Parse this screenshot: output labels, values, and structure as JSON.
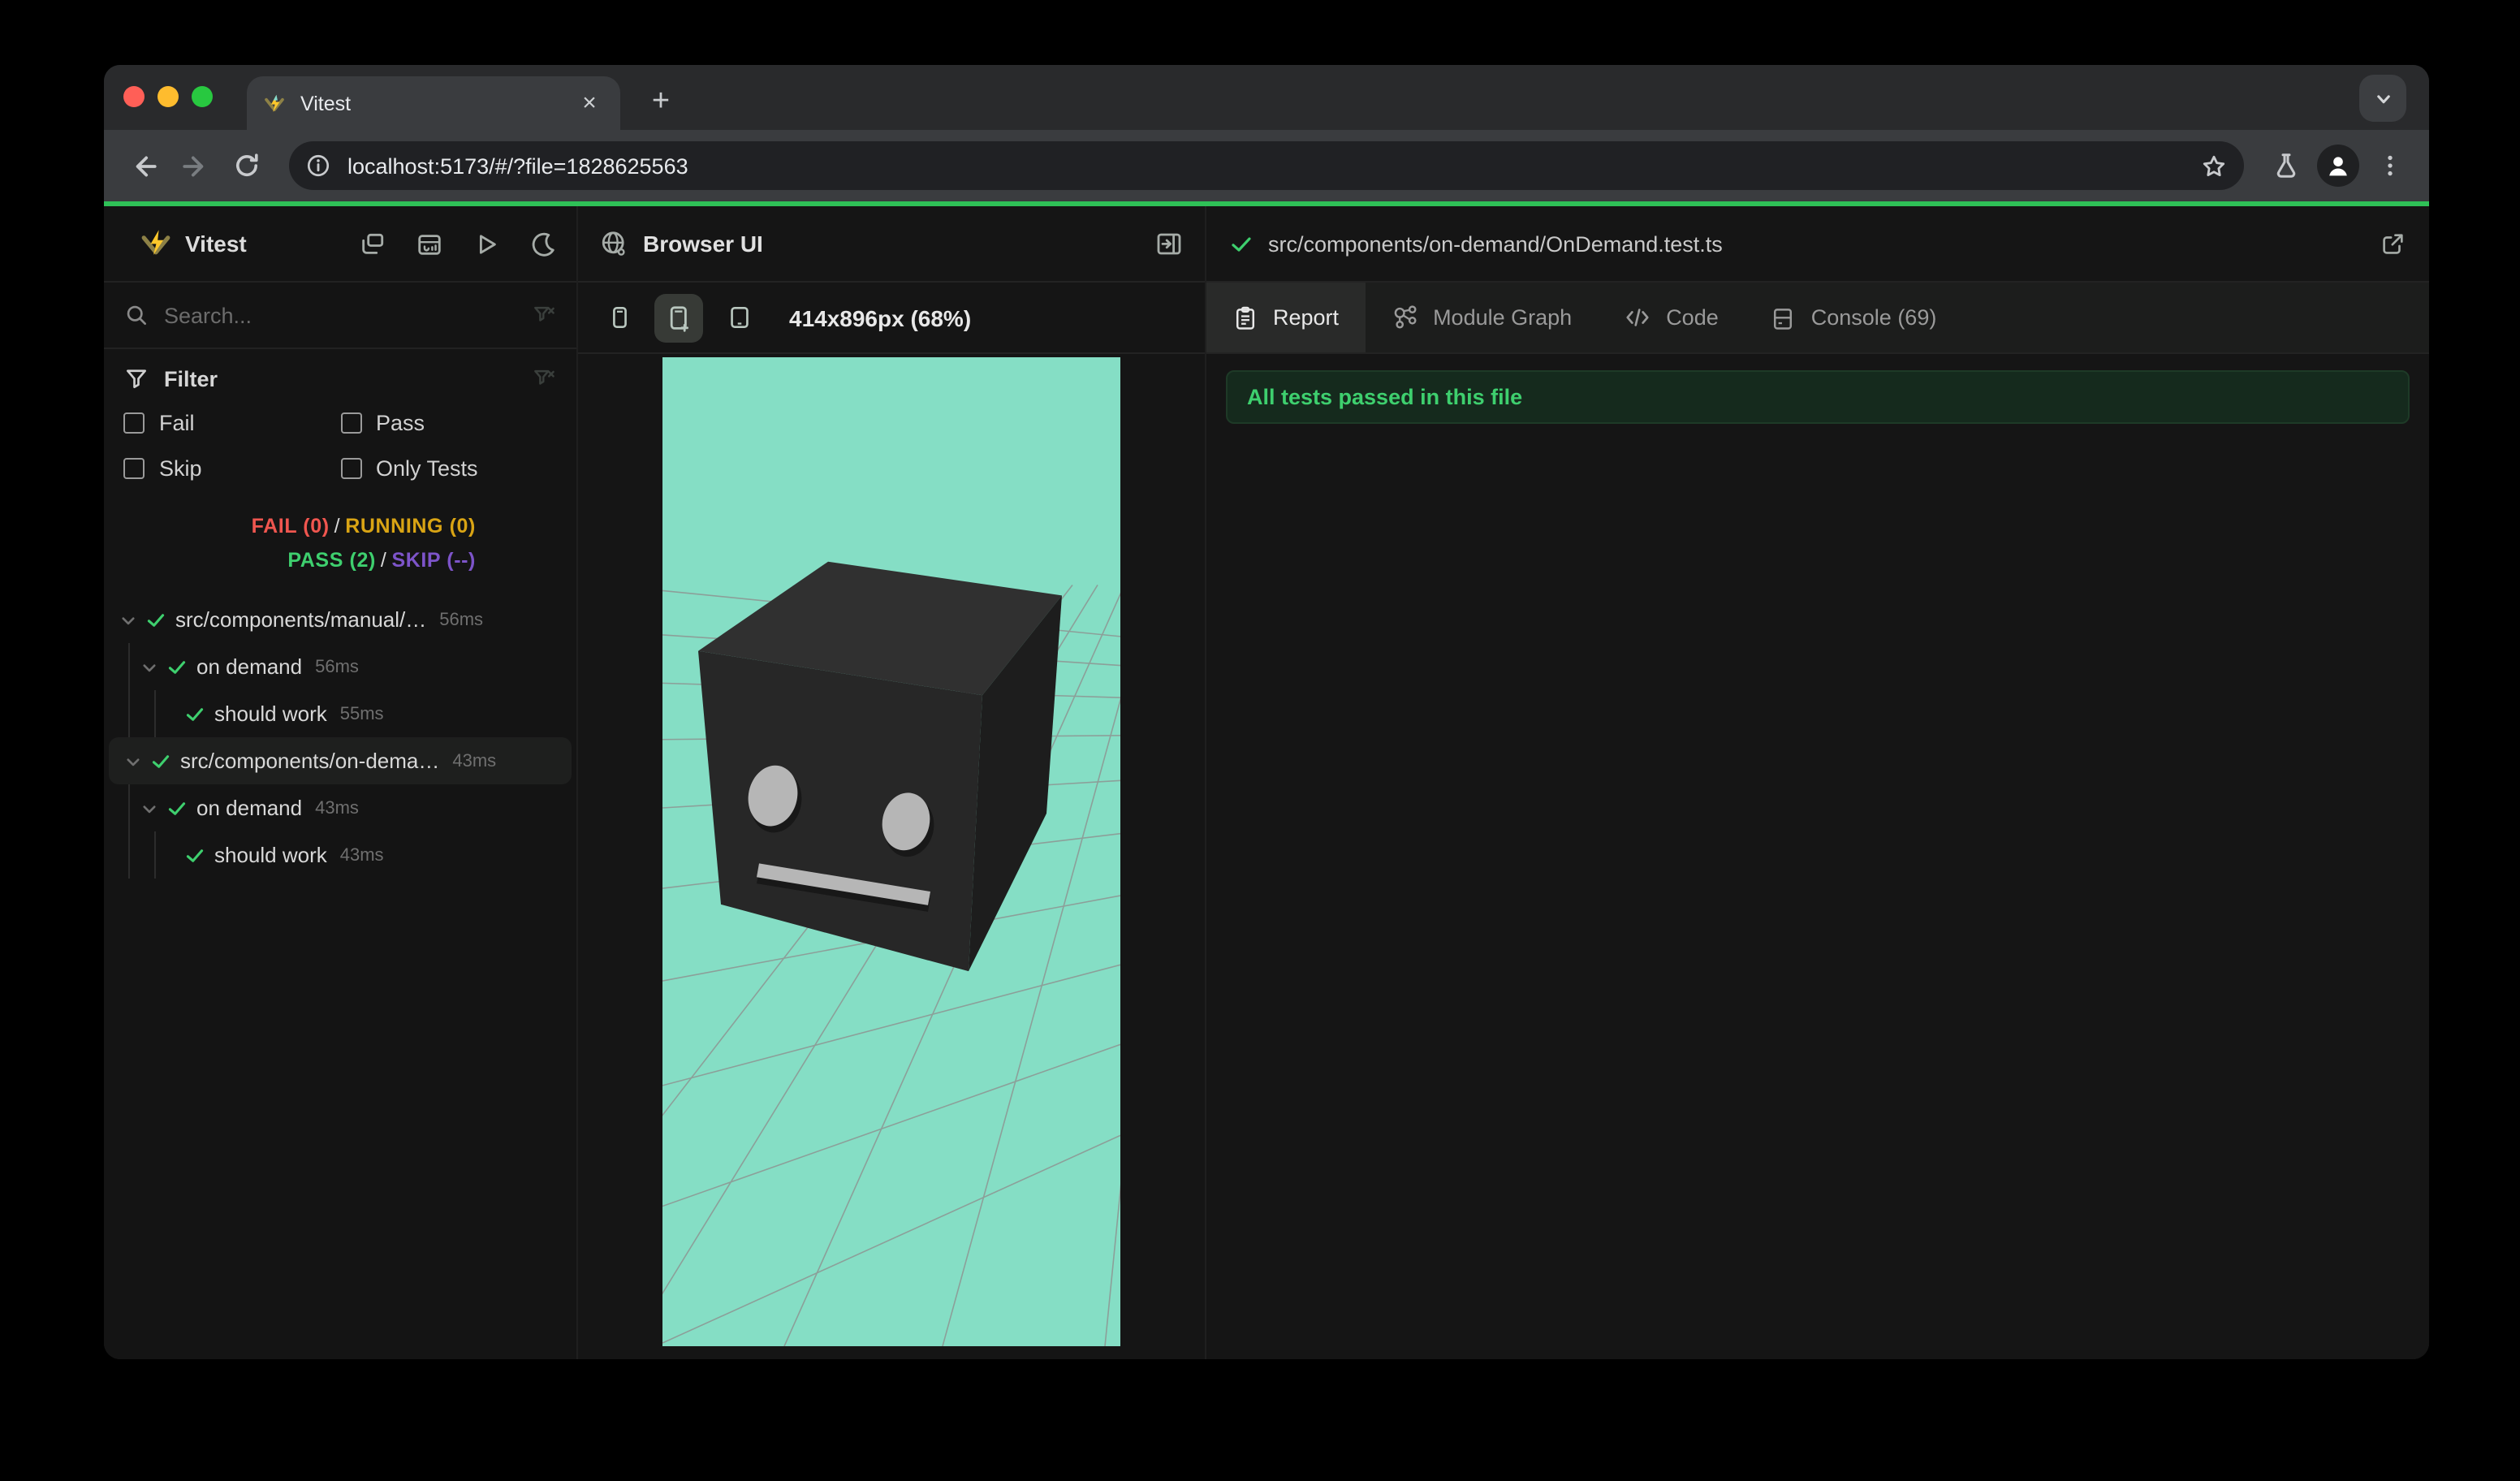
{
  "chrome": {
    "tab_title": "Vitest",
    "url": "localhost:5173/#/?file=1828625563",
    "glyphs": {
      "close": "×",
      "new_tab": "+"
    }
  },
  "sidebar": {
    "title": "Vitest",
    "search_placeholder": "Search...",
    "filter": {
      "label": "Filter",
      "checkboxes": [
        {
          "label": "Fail",
          "checked": false
        },
        {
          "label": "Pass",
          "checked": false
        },
        {
          "label": "Skip",
          "checked": false
        },
        {
          "label": "Only Tests",
          "checked": false
        }
      ]
    },
    "status": {
      "fail": "FAIL (0)",
      "running": "RUNNING (0)",
      "pass": "PASS (2)",
      "skip": "SKIP (--)",
      "separator": "/"
    },
    "tree": [
      {
        "name": "src/components/manual/…",
        "time": "56ms",
        "level": 0,
        "state": "pass",
        "selected": false
      },
      {
        "name": "on demand",
        "time": "56ms",
        "level": 1,
        "state": "pass",
        "selected": false
      },
      {
        "name": "should work",
        "time": "55ms",
        "level": 2,
        "state": "pass",
        "selected": false
      },
      {
        "name": "src/components/on-dema…",
        "time": "43ms",
        "level": 0,
        "state": "pass",
        "selected": true
      },
      {
        "name": "on demand",
        "time": "43ms",
        "level": 1,
        "state": "pass",
        "selected": false
      },
      {
        "name": "should work",
        "time": "43ms",
        "level": 2,
        "state": "pass",
        "selected": false
      }
    ]
  },
  "browser_panel": {
    "title": "Browser UI",
    "viewport_label": "414x896px (68%)",
    "devices": [
      "mobile-small",
      "mobile-plus",
      "tablet"
    ],
    "active_device": "mobile-plus"
  },
  "report_panel": {
    "file_path": "src/components/on-demand/OnDemand.test.ts",
    "file_state": "pass",
    "tabs": [
      {
        "label": "Report",
        "active": true
      },
      {
        "label": "Module Graph",
        "active": false
      },
      {
        "label": "Code",
        "active": false
      },
      {
        "label": "Console (69)",
        "active": false
      }
    ],
    "banner": "All tests passed in this file"
  },
  "colors": {
    "progress_green": "#2fc157",
    "pass_green": "#3ecf6e",
    "fail_red": "#f0564f",
    "running_amber": "#d9a414",
    "skip_purple": "#7d54c9",
    "viewport_mint": "#85dec5",
    "banner_bg": "#152a1d",
    "traffic_red": "#ff5f57",
    "traffic_yellow": "#febc2e",
    "traffic_green": "#28c840"
  }
}
